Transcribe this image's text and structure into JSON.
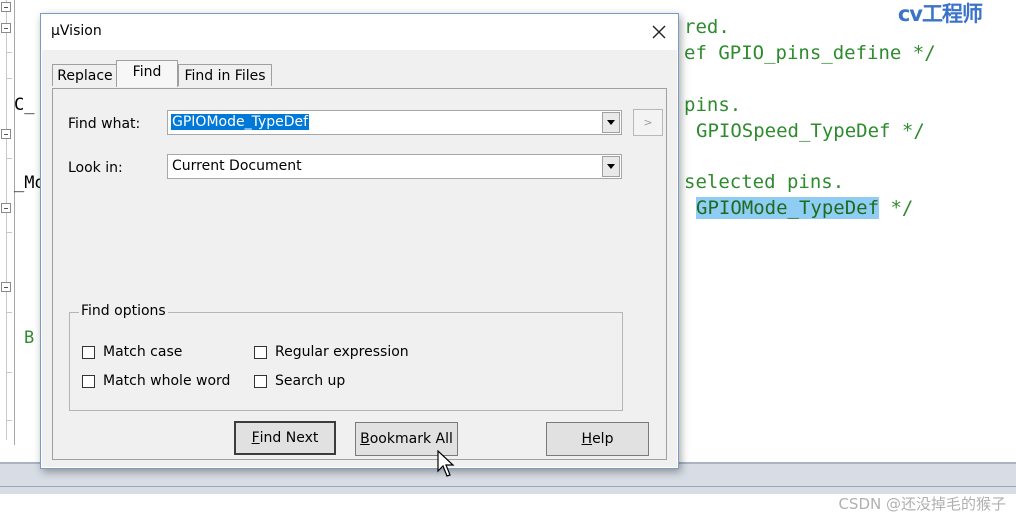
{
  "watermark": "cv工程师",
  "credit": "CSDN @还没掉毛的猴子",
  "code_lines": [
    {
      "text": "red."
    },
    {
      "text": "ef GPIO_pins_define */"
    },
    {
      "text": "pins."
    },
    {
      "text": "GPIOSpeed_TypeDef */"
    },
    {
      "text": "selected pins."
    },
    {
      "highlight": "GPIOMode_TypeDef",
      "tail": " */"
    }
  ],
  "left_fragments": [
    {
      "text": "C_"
    },
    {
      "text": "_Mo"
    },
    {
      "text": "B"
    }
  ],
  "dialog": {
    "title": "µVision",
    "tabs": [
      {
        "label": "Replace"
      },
      {
        "label": "Find"
      },
      {
        "label": "Find in Files"
      }
    ],
    "find_what_label": "Find what:",
    "find_what_value": "GPIOMode_TypeDef",
    "look_in_label": "Look in:",
    "look_in_value": "Current Document",
    "extra_button_label": ">",
    "find_options": {
      "title": "Find options",
      "match_case": "Match case",
      "match_whole_word": "Match whole word",
      "regular_expression": "Regular expression",
      "search_up": "Search up"
    },
    "buttons": {
      "find_next": {
        "mnemonic": "F",
        "rest": "ind Next"
      },
      "bookmark_all": {
        "mnemonic": "B",
        "rest": "ookmark All"
      },
      "help": {
        "mnemonic": "H",
        "rest": "elp"
      }
    }
  }
}
